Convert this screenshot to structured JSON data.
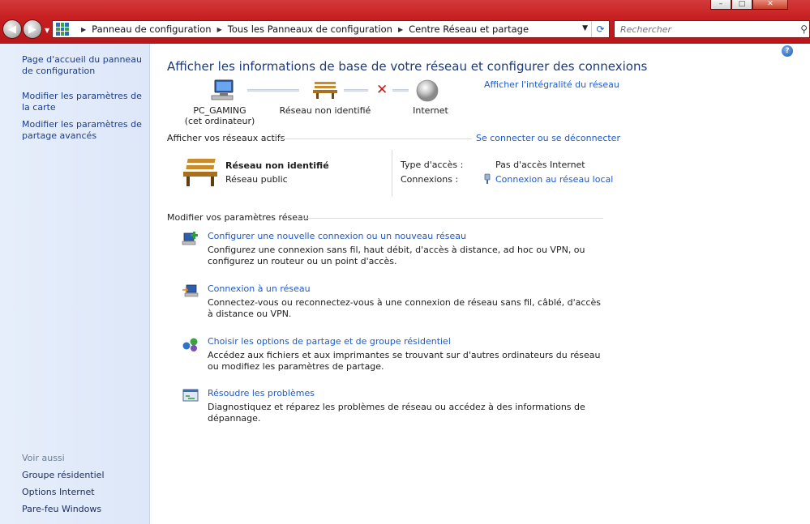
{
  "window": {
    "address": {
      "breadcrumbs": [
        "Panneau de configuration",
        "Tous les Panneaux de configuration",
        "Centre Réseau et partage"
      ]
    },
    "search_placeholder": "Rechercher"
  },
  "sidebar": {
    "links": [
      {
        "label": "Page d'accueil du panneau de configuration"
      },
      {
        "label": "Modifier les paramètres de la carte"
      },
      {
        "label": "Modifier les paramètres de partage avancés"
      }
    ],
    "see_also_heading": "Voir aussi",
    "see_also": [
      {
        "label": "Groupe résidentiel"
      },
      {
        "label": "Options Internet"
      },
      {
        "label": "Pare-feu Windows"
      }
    ]
  },
  "main": {
    "title": "Afficher les informations de base de votre réseau et configurer des connexions",
    "full_map_link": "Afficher l'intégralité du réseau",
    "map": {
      "computer_name": "PC_GAMING",
      "computer_sub": "(cet ordinateur)",
      "network_label": "Réseau non identifié",
      "internet_label": "Internet"
    },
    "active_networks": {
      "heading": "Afficher vos réseaux actifs",
      "connect_link": "Se connecter ou se déconnecter",
      "network_name": "Réseau non identifié",
      "network_type": "Réseau public",
      "access_type_label": "Type d'accès :",
      "access_type_value": "Pas d'accès Internet",
      "connections_label": "Connexions :",
      "connections_value": "Connexion au réseau local"
    },
    "settings": {
      "heading": "Modifier vos paramètres réseau",
      "tasks": [
        {
          "title": "Configurer une nouvelle connexion ou un nouveau réseau",
          "desc": "Configurez une connexion sans fil, haut débit, d'accès à distance, ad hoc ou VPN, ou configurez un routeur ou un point d'accès.",
          "icon": "new-connection-icon"
        },
        {
          "title": "Connexion à un réseau",
          "desc": "Connectez-vous ou reconnectez-vous à une connexion de réseau sans fil, câblé, d'accès à distance ou VPN.",
          "icon": "connect-network-icon"
        },
        {
          "title": "Choisir les options de partage et de groupe résidentiel",
          "desc": "Accédez aux fichiers et aux imprimantes se trouvant sur d'autres ordinateurs du réseau ou modifiez les paramètres de partage.",
          "icon": "homegroup-icon"
        },
        {
          "title": "Résoudre les problèmes",
          "desc": "Diagnostiquez et réparez les problèmes de réseau ou accédez à des informations de dépannage.",
          "icon": "troubleshoot-icon"
        }
      ]
    }
  }
}
